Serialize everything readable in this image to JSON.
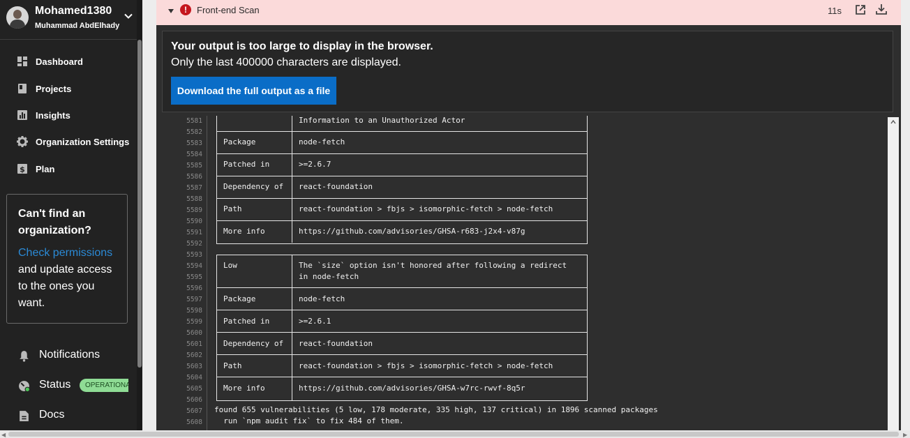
{
  "sidebar": {
    "username": "Mohamed1380",
    "fullname": "Muhammad AbdElhady",
    "nav": [
      {
        "label": "Dashboard",
        "icon": "dashboard-icon"
      },
      {
        "label": "Projects",
        "icon": "projects-icon"
      },
      {
        "label": "Insights",
        "icon": "insights-icon"
      },
      {
        "label": "Organization Settings",
        "icon": "gear-icon"
      },
      {
        "label": "Plan",
        "icon": "dollar-icon"
      }
    ],
    "org_card": {
      "title": "Can't find an organization?",
      "link": "Check permissions",
      "text": " and update access to the ones you want."
    },
    "bottom": {
      "notifications": "Notifications",
      "status": "Status",
      "status_badge": "OPERATIONAL",
      "docs": "Docs"
    }
  },
  "scan": {
    "title": "Front-end Scan",
    "duration": "11s"
  },
  "notice": {
    "title": "Your output is too large to display in the browser.",
    "subtitle": "Only the last 400000 characters are displayed.",
    "button": "Download the full output as a file"
  },
  "log": {
    "line_numbers": [
      "5581",
      "5582",
      "5583",
      "5584",
      "5585",
      "5586",
      "5587",
      "5588",
      "5589",
      "5590",
      "5591",
      "5592",
      "5593",
      "5594",
      "5595",
      "5596",
      "5597",
      "5598",
      "5599",
      "5600",
      "5601",
      "5602",
      "5603",
      "5604",
      "5605",
      "5606",
      "5607",
      "5608"
    ],
    "box1": {
      "partial_line": "Information to an Unauthorized Actor",
      "rows": [
        {
          "label": "Package",
          "value": "node-fetch"
        },
        {
          "label": "Patched in",
          "value": ">=2.6.7"
        },
        {
          "label": "Dependency of",
          "value": "react-foundation"
        },
        {
          "label": "Path",
          "value": "react-foundation > fbjs > isomorphic-fetch > node-fetch"
        },
        {
          "label": "More info",
          "value": "https://github.com/advisories/GHSA-r683-j2x4-v87g"
        }
      ]
    },
    "box2": {
      "severity": "Low",
      "title_line1": "The `size` option isn't honored after following a redirect",
      "title_line2": "in node-fetch",
      "rows": [
        {
          "label": "Package",
          "value": "node-fetch"
        },
        {
          "label": "Patched in",
          "value": ">=2.6.1"
        },
        {
          "label": "Dependency of",
          "value": "react-foundation"
        },
        {
          "label": "Path",
          "value": "react-foundation > fbjs > isomorphic-fetch > node-fetch"
        },
        {
          "label": "More info",
          "value": "https://github.com/advisories/GHSA-w7rc-rwvf-8q5r"
        }
      ]
    },
    "summary": "found 655 vulnerabilities (5 low, 178 moderate, 335 high, 137 critical) in 1896 scanned packages",
    "fix_hint": "  run `npm audit fix` to fix 484 of them."
  },
  "colors": {
    "sidebar_bg": "#222222",
    "terminal_bg": "#2e2e2e",
    "header_bg": "#fbdada",
    "error": "#c5161d",
    "button": "#0a6dc7",
    "link": "#2b8ad6",
    "status_badge": "#8fdc95"
  }
}
